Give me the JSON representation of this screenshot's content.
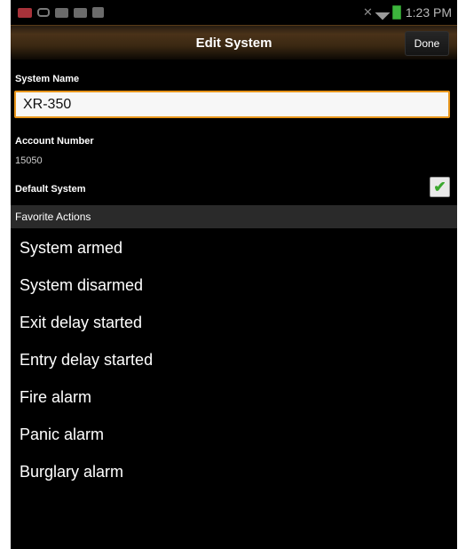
{
  "status_bar": {
    "time": "1:23 PM",
    "icons": [
      "notification-icon",
      "voicemail-icon",
      "message-icon",
      "message-icon",
      "image-icon",
      "mute-icon",
      "wifi-icon",
      "battery-icon"
    ]
  },
  "action_bar": {
    "title": "Edit System",
    "done_label": "Done"
  },
  "form": {
    "system_name_label": "System Name",
    "system_name_value": "XR-350",
    "account_number_label": "Account Number",
    "account_number_value": "15050",
    "default_system_label": "Default System",
    "default_system_checked": true
  },
  "favorites": {
    "header": "Favorite Actions",
    "items": [
      "System armed",
      "System disarmed",
      "Exit delay started",
      "Entry delay started",
      "Fire alarm",
      "Panic alarm",
      "Burglary alarm"
    ]
  },
  "colors": {
    "accent_orange": "#e8961c",
    "check_green": "#3aa82d",
    "section_bg": "#2a2a2a",
    "background": "#000000"
  }
}
